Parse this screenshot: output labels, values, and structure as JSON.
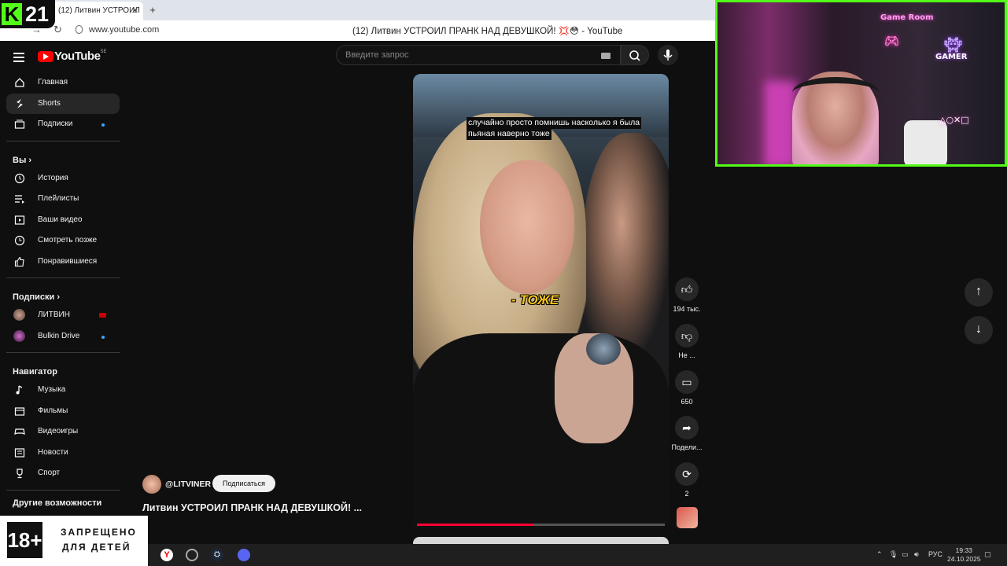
{
  "overlay": {
    "kick_badge": "21",
    "age_rating": "18+",
    "age_text_line1": "ЗАПРЕЩЕНО",
    "age_text_line2": "ДЛЯ ДЕТЕЙ"
  },
  "browser": {
    "tab_title": "(12) Литвин УСТРОИЛ",
    "url": "www.youtube.com",
    "window_title": "(12) Литвин УСТРОИЛ ПРАНК НАД ДЕВУШКОЙ! 💢😳 - YouTube"
  },
  "youtube": {
    "logo": "YouTube",
    "logo_country": "SE",
    "search_placeholder": "Введите запрос",
    "sidebar": {
      "main": [
        {
          "label": "Главная",
          "icon": "home-icon"
        },
        {
          "label": "Shorts",
          "icon": "shorts-icon",
          "active": true
        },
        {
          "label": "Подписки",
          "icon": "subscriptions-icon"
        }
      ],
      "you_header": "Вы",
      "you": [
        {
          "label": "История",
          "icon": "history-icon"
        },
        {
          "label": "Плейлисты",
          "icon": "playlists-icon"
        },
        {
          "label": "Ваши видео",
          "icon": "your-videos-icon"
        },
        {
          "label": "Смотреть позже",
          "icon": "watch-later-icon"
        },
        {
          "label": "Понравившиеся",
          "icon": "liked-icon"
        }
      ],
      "subs_header": "Подписки",
      "subs": [
        {
          "label": "ЛИТВИН"
        },
        {
          "label": "Bulkin Drive"
        }
      ],
      "nav_header": "Навигатор",
      "nav": [
        {
          "label": "Музыка",
          "icon": "music-icon"
        },
        {
          "label": "Фильмы",
          "icon": "movies-icon"
        },
        {
          "label": "Видеоигры",
          "icon": "gaming-icon"
        },
        {
          "label": "Новости",
          "icon": "news-icon"
        },
        {
          "label": "Спорт",
          "icon": "sport-icon"
        }
      ],
      "more_header": "Другие возможности"
    },
    "short": {
      "caption_line1": "случайно просто помнишь насколько я была",
      "caption_line2": "пьяная наверно тоже",
      "burned_caption": "- ТОЖЕ",
      "progress": 0.47,
      "channel": "@LITVINER",
      "subscribe": "Подписаться",
      "title": "Литвин УСТРОИЛ ПРАНК НАД ДЕВУШКОЙ! ..."
    },
    "actions": {
      "likes": "194 тыс.",
      "dislike": "Не ...",
      "comments": "650",
      "share": "Подели...",
      "remix": "2"
    }
  },
  "webcam": {
    "neon_game_room": "Game Room",
    "neon_gamer": "GAMER"
  },
  "taskbar": {
    "language": "РУС",
    "time": "19:33",
    "date": "24.10.2025"
  }
}
